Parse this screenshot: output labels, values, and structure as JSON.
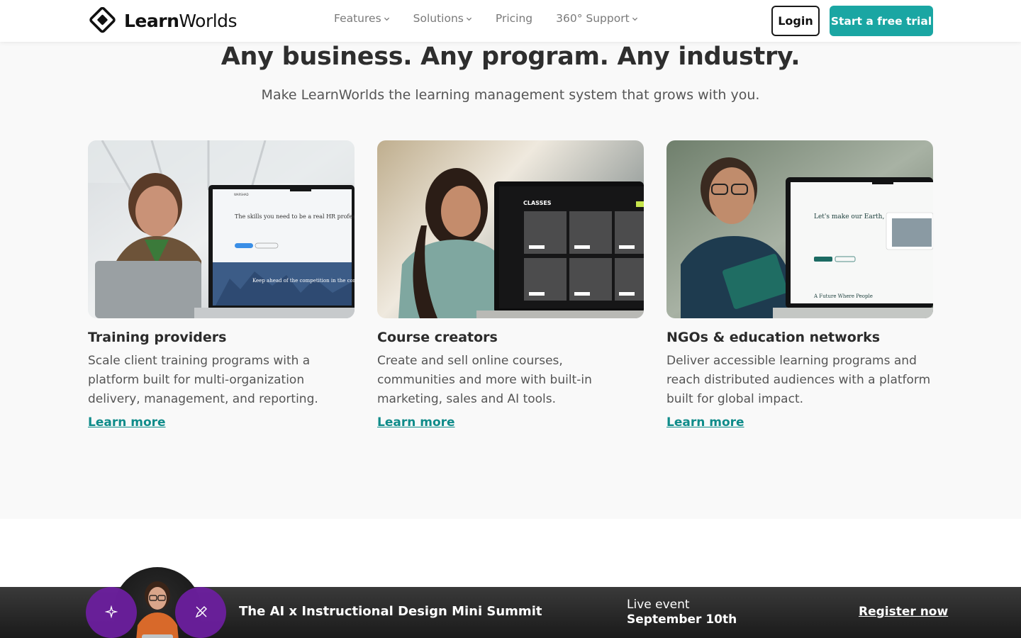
{
  "header": {
    "logo_bold": "Learn",
    "logo_light": "Worlds",
    "nav": [
      {
        "label": "Features",
        "has_dropdown": true
      },
      {
        "label": "Solutions",
        "has_dropdown": true
      },
      {
        "label": "Pricing",
        "has_dropdown": false
      },
      {
        "label": "360° Support",
        "has_dropdown": true
      }
    ],
    "login_label": "Login",
    "trial_label": "Start a free trial"
  },
  "hero": {
    "title": "Any business. Any program. Any industry.",
    "subtitle": "Make LearnWorlds the learning management system that grows with you."
  },
  "cards": [
    {
      "title": "Training providers",
      "description": "Scale client training programs with a platform built for multi-organization delivery, management, and reporting.",
      "link": "Learn more",
      "screen_heading": "The skills you need to be a real HR professional",
      "screen_footer": "Keep ahead of the competition in the corporate world",
      "screen_brand": "WARSHAD"
    },
    {
      "title": "Course creators",
      "description": "Create and sell online courses, communities and more with built-in marketing, sales and AI tools.",
      "link": "Learn more",
      "screen_heading": "CLASSES",
      "screen_tiles": [
        "CONTENT MARKETING",
        "MASTER CERTIFICATION IN MARKET RESEARCH",
        "READ, WATCH, LEARN, IMPROVE",
        "THE FUNDAMENTALS OF CLASSIC ART CREATION",
        "DESIGN THEORY ESSENTIALS",
        "DEVELOP YOUR PROFESSIONAL SKILLS"
      ]
    },
    {
      "title": "NGOs & education networks",
      "description": "Deliver accessible learning programs and reach distributed audiences with a platform built for global impact.",
      "link": "Learn more",
      "screen_heading": "Let's make our Earth, Green & Clean",
      "screen_footer": "A Future Where People"
    }
  ],
  "banner": {
    "title": "The AI x Instructional Design Mini Summit",
    "live_label": "Live event",
    "date": "September 10th",
    "register_label": "Register now"
  },
  "colors": {
    "accent": "#1aa6a3",
    "link": "#0f8c8a",
    "purple": "#6c1f9e"
  }
}
